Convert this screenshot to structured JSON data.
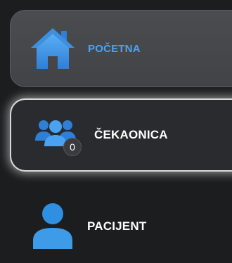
{
  "sidebar": {
    "items": [
      {
        "label": "POČETNA",
        "icon": "home-icon",
        "state": "selected"
      },
      {
        "label": "ČEKAONICA",
        "icon": "group-icon",
        "badge": "0",
        "state": "hover"
      },
      {
        "label": "PACIJENT",
        "icon": "user-icon",
        "state": "default"
      }
    ]
  },
  "colors": {
    "accent": "#4da3f0",
    "icon_blue": "#3d8fe0",
    "background": "#1c1d1f"
  }
}
